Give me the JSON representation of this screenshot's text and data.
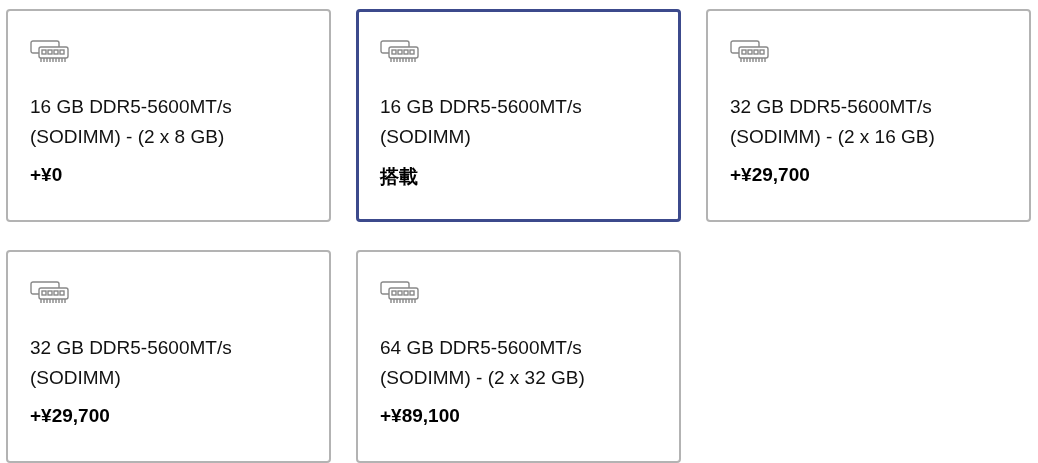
{
  "options": [
    {
      "name": "16 GB DDR5-5600MT/s (SODIMM) - (2 x 8 GB)",
      "price": "+¥0",
      "selected": false
    },
    {
      "name": "16 GB DDR5-5600MT/s (SODIMM)",
      "price": "搭載",
      "selected": true
    },
    {
      "name": "32 GB DDR5-5600MT/s (SODIMM) - (2 x 16 GB)",
      "price": "+¥29,700",
      "selected": false
    },
    {
      "name": "32 GB DDR5-5600MT/s (SODIMM)",
      "price": "+¥29,700",
      "selected": false
    },
    {
      "name": "64 GB DDR5-5600MT/s (SODIMM) - (2 x 32 GB)",
      "price": "+¥89,100",
      "selected": false
    }
  ]
}
